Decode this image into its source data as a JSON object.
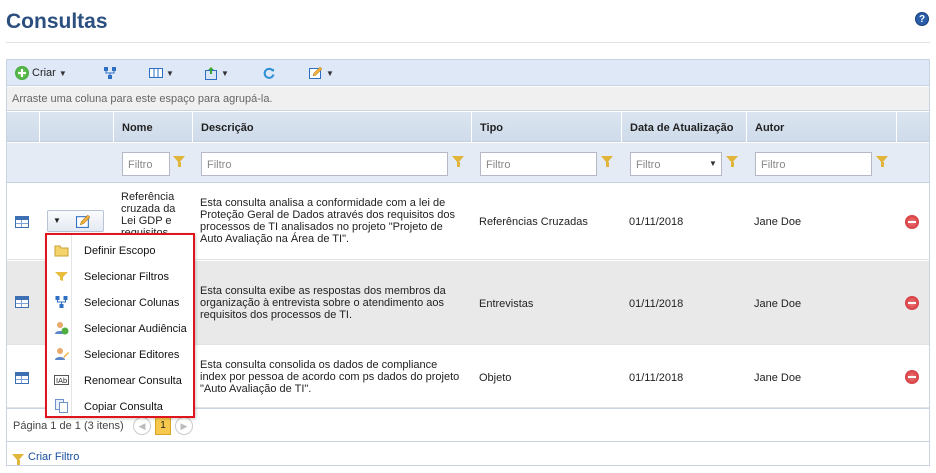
{
  "page": {
    "title": "Consultas",
    "help_label": "?"
  },
  "toolbar": {
    "criar_label": "Criar",
    "icons": [
      "add-icon",
      "hierarchy-icon",
      "columns-icon",
      "export-icon",
      "refresh-icon",
      "edit-icon"
    ]
  },
  "grouping": {
    "hint": "Arraste uma coluna para este espaço para agrupá-la."
  },
  "columns": {
    "nome": "Nome",
    "descricao": "Descrição",
    "tipo": "Tipo",
    "data": "Data de Atualização",
    "autor": "Autor"
  },
  "filter": {
    "placeholder": "Filtro"
  },
  "rows": [
    {
      "nome": "Referência cruzada da Lei GDP e requisitos",
      "descricao": "Esta consulta analisa a conformidade com a lei de Proteção Geral de Dados através dos requisitos dos processos de TI analisados no projeto \"Projeto de Auto Avaliação na Área de TI\".",
      "tipo": "Referências Cruzadas",
      "data": "01/11/2018",
      "autor": "Jane Doe"
    },
    {
      "nome": "",
      "descricao": "Esta consulta exibe as respostas dos membros da organização à entrevista sobre o atendimento aos requisitos dos processos de TI.",
      "tipo": "Entrevistas",
      "data": "01/11/2018",
      "autor": "Jane Doe"
    },
    {
      "nome": "",
      "descricao": "Esta consulta consolida os dados de compliance index por pessoa de acordo com ps dados do projeto \"Auto Avaliação de TI\".",
      "tipo": "Objeto",
      "data": "01/11/2018",
      "autor": "Jane Doe"
    }
  ],
  "context_menu": {
    "items": [
      {
        "label": "Definir Escopo",
        "icon": "folder-icon"
      },
      {
        "label": "Selecionar Filtros",
        "icon": "filter-icon"
      },
      {
        "label": "Selecionar Colunas",
        "icon": "hierarchy-icon"
      },
      {
        "label": "Selecionar Audiência",
        "icon": "audience-icon"
      },
      {
        "label": "Selecionar Editores",
        "icon": "editors-icon"
      },
      {
        "label": "Renomear Consulta",
        "icon": "rename-icon"
      },
      {
        "label": "Copiar Consulta",
        "icon": "copy-icon"
      }
    ]
  },
  "pager": {
    "text": "Página 1 de 1 (3 itens)",
    "current_page": "1"
  },
  "footer": {
    "criar_filtro": "Criar Filtro"
  }
}
